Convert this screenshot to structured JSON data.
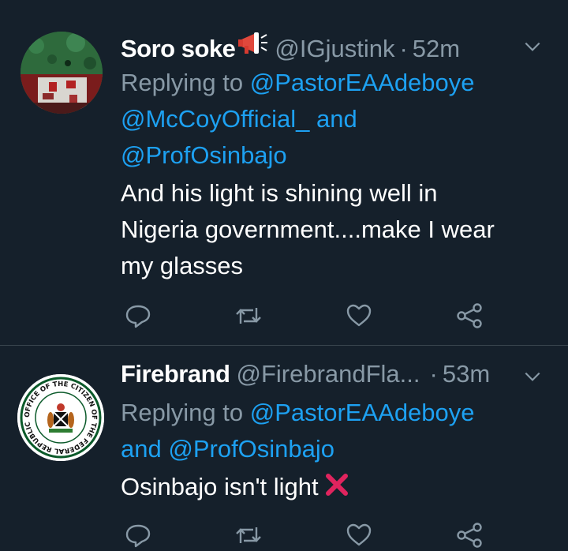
{
  "tweets": [
    {
      "name": "Soro soke",
      "name_emoji_icon": "megaphone-icon",
      "handle": "@IGjustink",
      "dot": "·",
      "time": "52m",
      "replying_prefix": "Replying to",
      "mentions": [
        "@PastorEAAdeboye",
        "@McCoyOfficial_",
        "@ProfOsinbajo"
      ],
      "and": "and",
      "text_lines": [
        "And his light is shining well in",
        "Nigeria government....make I wear",
        "my glasses"
      ]
    },
    {
      "name": "Firebrand",
      "handle": "@FirebrandFla...",
      "dot": "·",
      "time": "53m",
      "replying_prefix": "Replying to",
      "mentions": [
        "@PastorEAAdeboye",
        "@ProfOsinbajo"
      ],
      "and": "and",
      "text": "Osinbajo isn't light",
      "text_emoji_icon": "cross-mark-icon",
      "avatar_text": "OFFICE OF THE CITIZEN OF THE FEDERAL REPUBLIC OF NIGERIA"
    }
  ],
  "colors": {
    "background": "#15202b",
    "secondary_text": "#8899a6",
    "mention": "#1da1f2",
    "divider": "#38444d"
  },
  "icons": [
    "reply-icon",
    "retweet-icon",
    "like-icon",
    "share-icon",
    "chevron-down-icon"
  ]
}
